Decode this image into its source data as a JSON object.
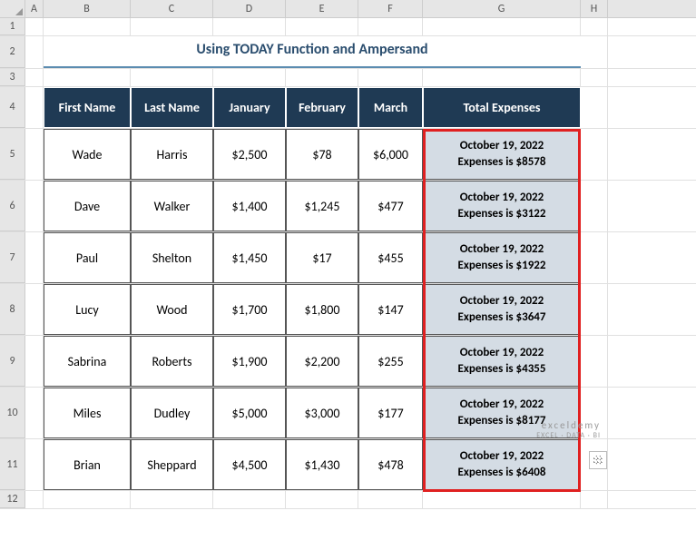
{
  "columns": [
    "A",
    "B",
    "C",
    "D",
    "E",
    "F",
    "G",
    "H"
  ],
  "rows": [
    "1",
    "2",
    "3",
    "4",
    "5",
    "6",
    "7",
    "8",
    "9",
    "10",
    "11",
    "12"
  ],
  "title": "Using TODAY Function and Ampersand",
  "headers": {
    "first_name": "First Name",
    "last_name": "Last Name",
    "january": "January",
    "february": "February",
    "march": "March",
    "total": "Total Expenses"
  },
  "data": [
    {
      "first": "Wade",
      "last": "Harris",
      "jan": "$2,500",
      "feb": "$78",
      "mar": "$6,000",
      "date": "October 19, 2022",
      "exp": "Expenses is $8578"
    },
    {
      "first": "Dave",
      "last": "Walker",
      "jan": "$1,400",
      "feb": "$1,245",
      "mar": "$477",
      "date": "October 19, 2022",
      "exp": "Expenses is $3122"
    },
    {
      "first": "Paul",
      "last": "Shelton",
      "jan": "$1,450",
      "feb": "$17",
      "mar": "$455",
      "date": "October 19, 2022",
      "exp": "Expenses is $1922"
    },
    {
      "first": "Lucy",
      "last": "Wood",
      "jan": "$1,700",
      "feb": "$1,800",
      "mar": "$147",
      "date": "October 19, 2022",
      "exp": "Expenses is $3647"
    },
    {
      "first": "Sabrina",
      "last": "Roberts",
      "jan": "$1,900",
      "feb": "$2,200",
      "mar": "$255",
      "date": "October 19, 2022",
      "exp": "Expenses is $4355"
    },
    {
      "first": "Miles",
      "last": "Dudley",
      "jan": "$5,000",
      "feb": "$3,000",
      "mar": "$177",
      "date": "October 19, 2022",
      "exp": "Expenses is $8177"
    },
    {
      "first": "Brian",
      "last": "Sheppard",
      "jan": "$4,500",
      "feb": "$1,430",
      "mar": "$478",
      "date": "October 19, 2022",
      "exp": "Expenses is $6408"
    }
  ],
  "watermark": {
    "brand": "exceldemy",
    "tagline": "EXCEL · DATA · BI"
  }
}
